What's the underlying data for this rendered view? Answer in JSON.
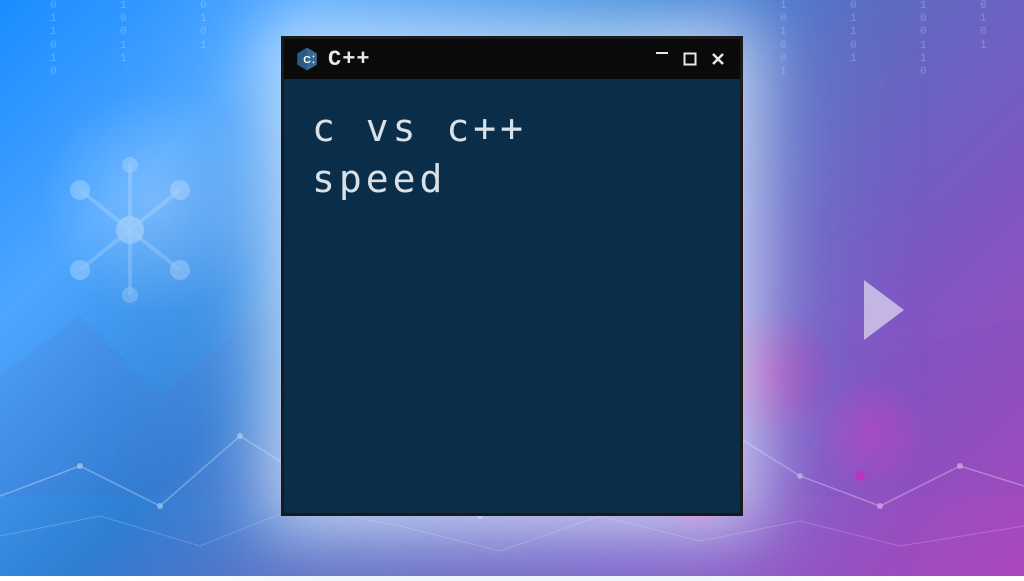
{
  "window": {
    "title": "C++",
    "icon": "cpp-logo"
  },
  "terminal": {
    "line1": "c vs c++",
    "line2": "speed"
  },
  "controls": {
    "minimize": "–",
    "maximize": "▢",
    "close": "✕"
  }
}
